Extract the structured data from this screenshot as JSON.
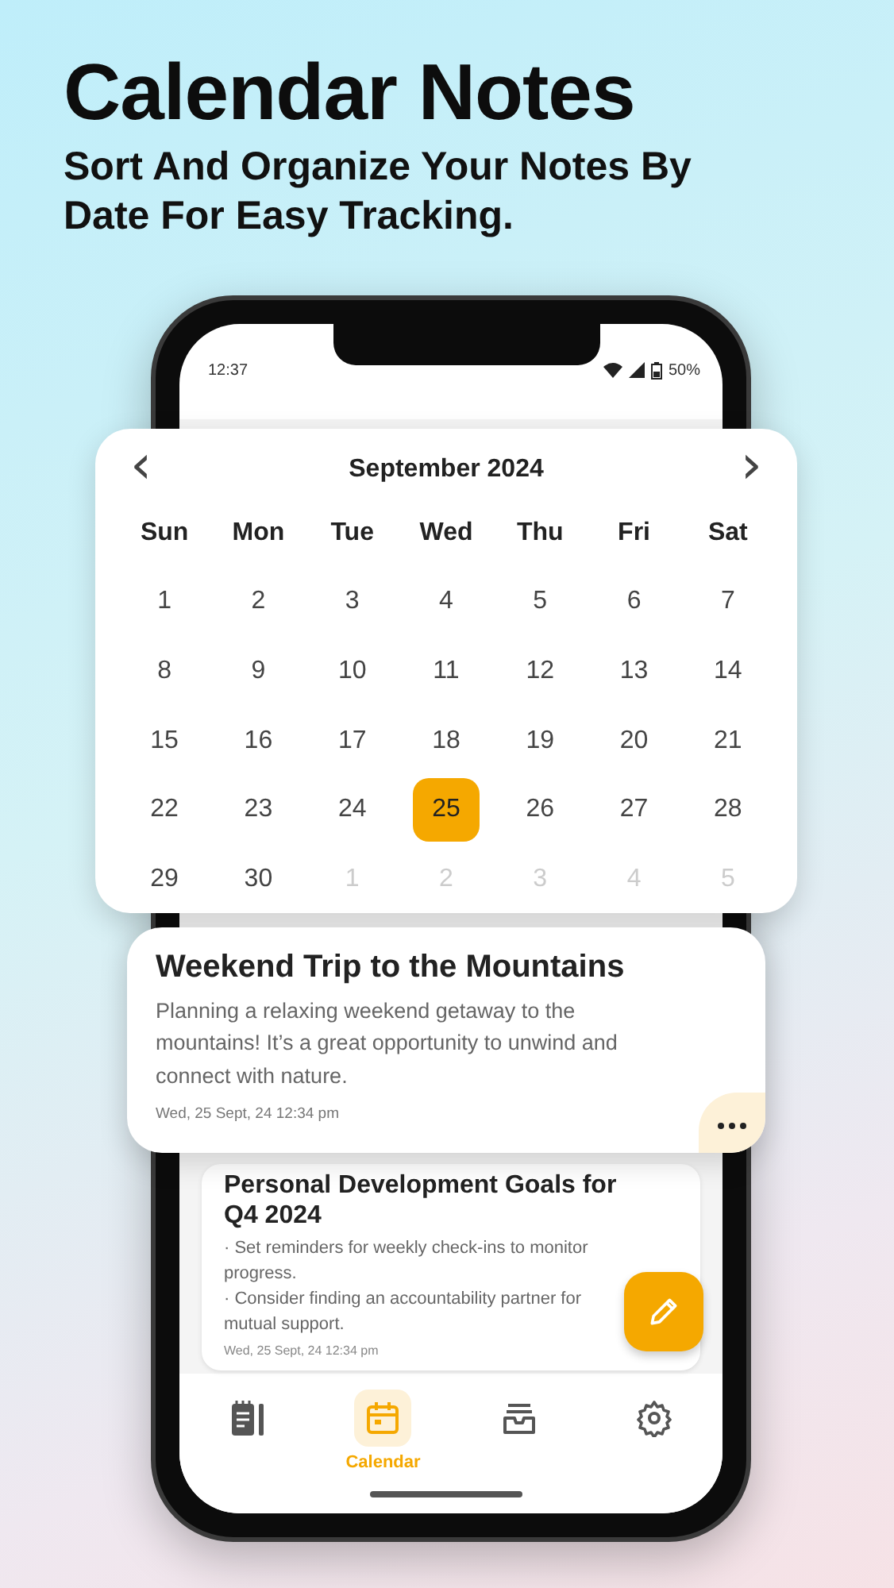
{
  "headline": "Calendar Notes",
  "subheadline": "Sort And Organize Your Notes By Date For Easy Tracking.",
  "status_bar": {
    "time": "12:37",
    "battery": "50%"
  },
  "calendar": {
    "prev": "‹",
    "next": "›",
    "month": "September 2024",
    "weekdays": [
      "Sun",
      "Mon",
      "Tue",
      "Wed",
      "Thu",
      "Fri",
      "Sat"
    ],
    "days": [
      {
        "label": "1",
        "selected": false,
        "outside": false
      },
      {
        "label": "2",
        "selected": false,
        "outside": false
      },
      {
        "label": "3",
        "selected": false,
        "outside": false
      },
      {
        "label": "4",
        "selected": false,
        "outside": false
      },
      {
        "label": "5",
        "selected": false,
        "outside": false
      },
      {
        "label": "6",
        "selected": false,
        "outside": false
      },
      {
        "label": "7",
        "selected": false,
        "outside": false
      },
      {
        "label": "8",
        "selected": false,
        "outside": false
      },
      {
        "label": "9",
        "selected": false,
        "outside": false
      },
      {
        "label": "10",
        "selected": false,
        "outside": false
      },
      {
        "label": "11",
        "selected": false,
        "outside": false
      },
      {
        "label": "12",
        "selected": false,
        "outside": false
      },
      {
        "label": "13",
        "selected": false,
        "outside": false
      },
      {
        "label": "14",
        "selected": false,
        "outside": false
      },
      {
        "label": "15",
        "selected": false,
        "outside": false
      },
      {
        "label": "16",
        "selected": false,
        "outside": false
      },
      {
        "label": "17",
        "selected": false,
        "outside": false
      },
      {
        "label": "18",
        "selected": false,
        "outside": false
      },
      {
        "label": "19",
        "selected": false,
        "outside": false
      },
      {
        "label": "20",
        "selected": false,
        "outside": false
      },
      {
        "label": "21",
        "selected": false,
        "outside": false
      },
      {
        "label": "22",
        "selected": false,
        "outside": false
      },
      {
        "label": "23",
        "selected": false,
        "outside": false
      },
      {
        "label": "24",
        "selected": false,
        "outside": false
      },
      {
        "label": "25",
        "selected": true,
        "outside": false
      },
      {
        "label": "26",
        "selected": false,
        "outside": false
      },
      {
        "label": "27",
        "selected": false,
        "outside": false
      },
      {
        "label": "28",
        "selected": false,
        "outside": false
      },
      {
        "label": "29",
        "selected": false,
        "outside": false
      },
      {
        "label": "30",
        "selected": false,
        "outside": false
      },
      {
        "label": "1",
        "selected": false,
        "outside": true
      },
      {
        "label": "2",
        "selected": false,
        "outside": true
      },
      {
        "label": "3",
        "selected": false,
        "outside": true
      },
      {
        "label": "4",
        "selected": false,
        "outside": true
      },
      {
        "label": "5",
        "selected": false,
        "outside": true
      }
    ]
  },
  "featured_note": {
    "title": "Weekend Trip to the Mountains",
    "body": "Planning a relaxing weekend getaway to the mountains! It’s a great opportunity to unwind and connect with nature.",
    "date": "Wed, 25 Sept, 24 12:34 pm"
  },
  "notes": [
    {
      "title": "Personal Development Goals for Q4 2024",
      "lines": [
        "· Set reminders for weekly check-ins to monitor progress.",
        "· Consider finding an accountability partner for mutual support."
      ],
      "date": "Wed, 25 Sept, 24 12:34 pm"
    }
  ],
  "nav": [
    {
      "kind": "notes",
      "selected": false
    },
    {
      "kind": "calendar",
      "label": "Calendar",
      "selected": true
    },
    {
      "kind": "archive",
      "selected": false
    },
    {
      "kind": "settings",
      "selected": false
    }
  ]
}
